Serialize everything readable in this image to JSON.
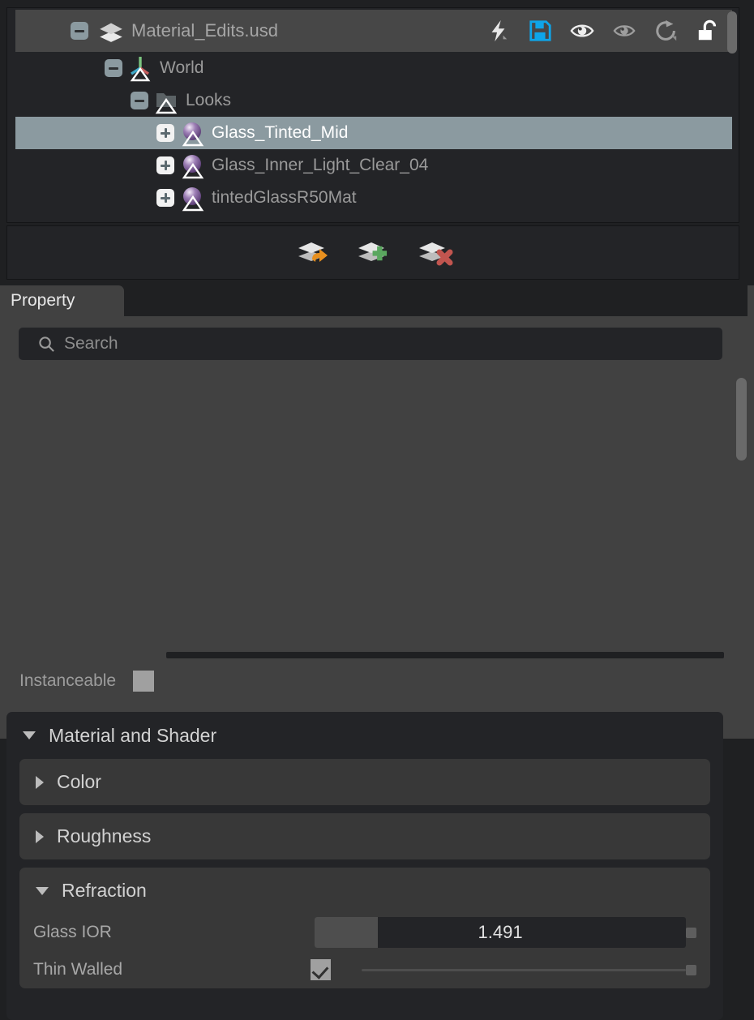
{
  "layer_panel": {
    "root_layer": {
      "title": "Material_Edits.usd",
      "expander": "minus",
      "icon": "layers-stack-icon"
    },
    "header_icons": [
      {
        "name": "lightning-icon",
        "label": "Lightning"
      },
      {
        "name": "save-icon",
        "label": "Save",
        "color": "#0ea5e9"
      },
      {
        "name": "eye-visible-icon",
        "label": "Visibility"
      },
      {
        "name": "eye-dim-icon",
        "label": "Global Visibility"
      },
      {
        "name": "reload-icon",
        "label": "Reload"
      },
      {
        "name": "unlock-icon",
        "label": "Unlock"
      }
    ],
    "tree": [
      {
        "label": "World",
        "expander": "minus",
        "icon": "axis-gizmo-icon",
        "indent": 110,
        "selected": false
      },
      {
        "label": "Looks",
        "expander": "minus",
        "icon": "folder-icon",
        "indent": 142,
        "selected": false
      },
      {
        "label": "Glass_Tinted_Mid",
        "expander": "plus",
        "icon": "material-ball-icon",
        "indent": 174,
        "selected": true
      },
      {
        "label": "Glass_Inner_Light_Clear_04",
        "expander": "plus",
        "icon": "material-ball-icon",
        "indent": 174,
        "selected": false
      },
      {
        "label": "tintedGlassR50Mat",
        "expander": "plus",
        "icon": "material-ball-icon",
        "indent": 174,
        "selected": false
      }
    ],
    "buttons": [
      {
        "name": "move-layer-button",
        "label": "Move Prim Spec to Layer"
      },
      {
        "name": "create-layer-button",
        "label": "Create Layer"
      },
      {
        "name": "remove-layer-button",
        "label": "Remove Layer"
      }
    ]
  },
  "property_panel": {
    "tab_label": "Property",
    "search": {
      "placeholder": "Search",
      "value": ""
    },
    "instanceable": {
      "label": "Instanceable",
      "checked": false
    },
    "groups": [
      {
        "name": "material-and-shader",
        "title": "Material and Shader",
        "expanded": true,
        "subgroups": [
          {
            "name": "color",
            "title": "Color",
            "expanded": false
          },
          {
            "name": "roughness",
            "title": "Roughness",
            "expanded": false
          },
          {
            "name": "refraction",
            "title": "Refraction",
            "expanded": true,
            "properties": [
              {
                "name": "glass-ior",
                "label": "Glass IOR",
                "type": "slider",
                "value": "1.491",
                "fill_ratio": 0.168
              },
              {
                "name": "thin-walled",
                "label": "Thin Walled",
                "type": "checkbox",
                "checked": true
              }
            ]
          }
        ]
      }
    ]
  },
  "colors": {
    "window_bg": "#1f2022",
    "panel_bg": "#414141",
    "tree_bg": "#232427",
    "header_bg": "#474747",
    "selection": "#8b9aa0",
    "accent_blue": "#0ea5e9",
    "group_bg": "#232427",
    "subgroup_bg": "#383838"
  }
}
